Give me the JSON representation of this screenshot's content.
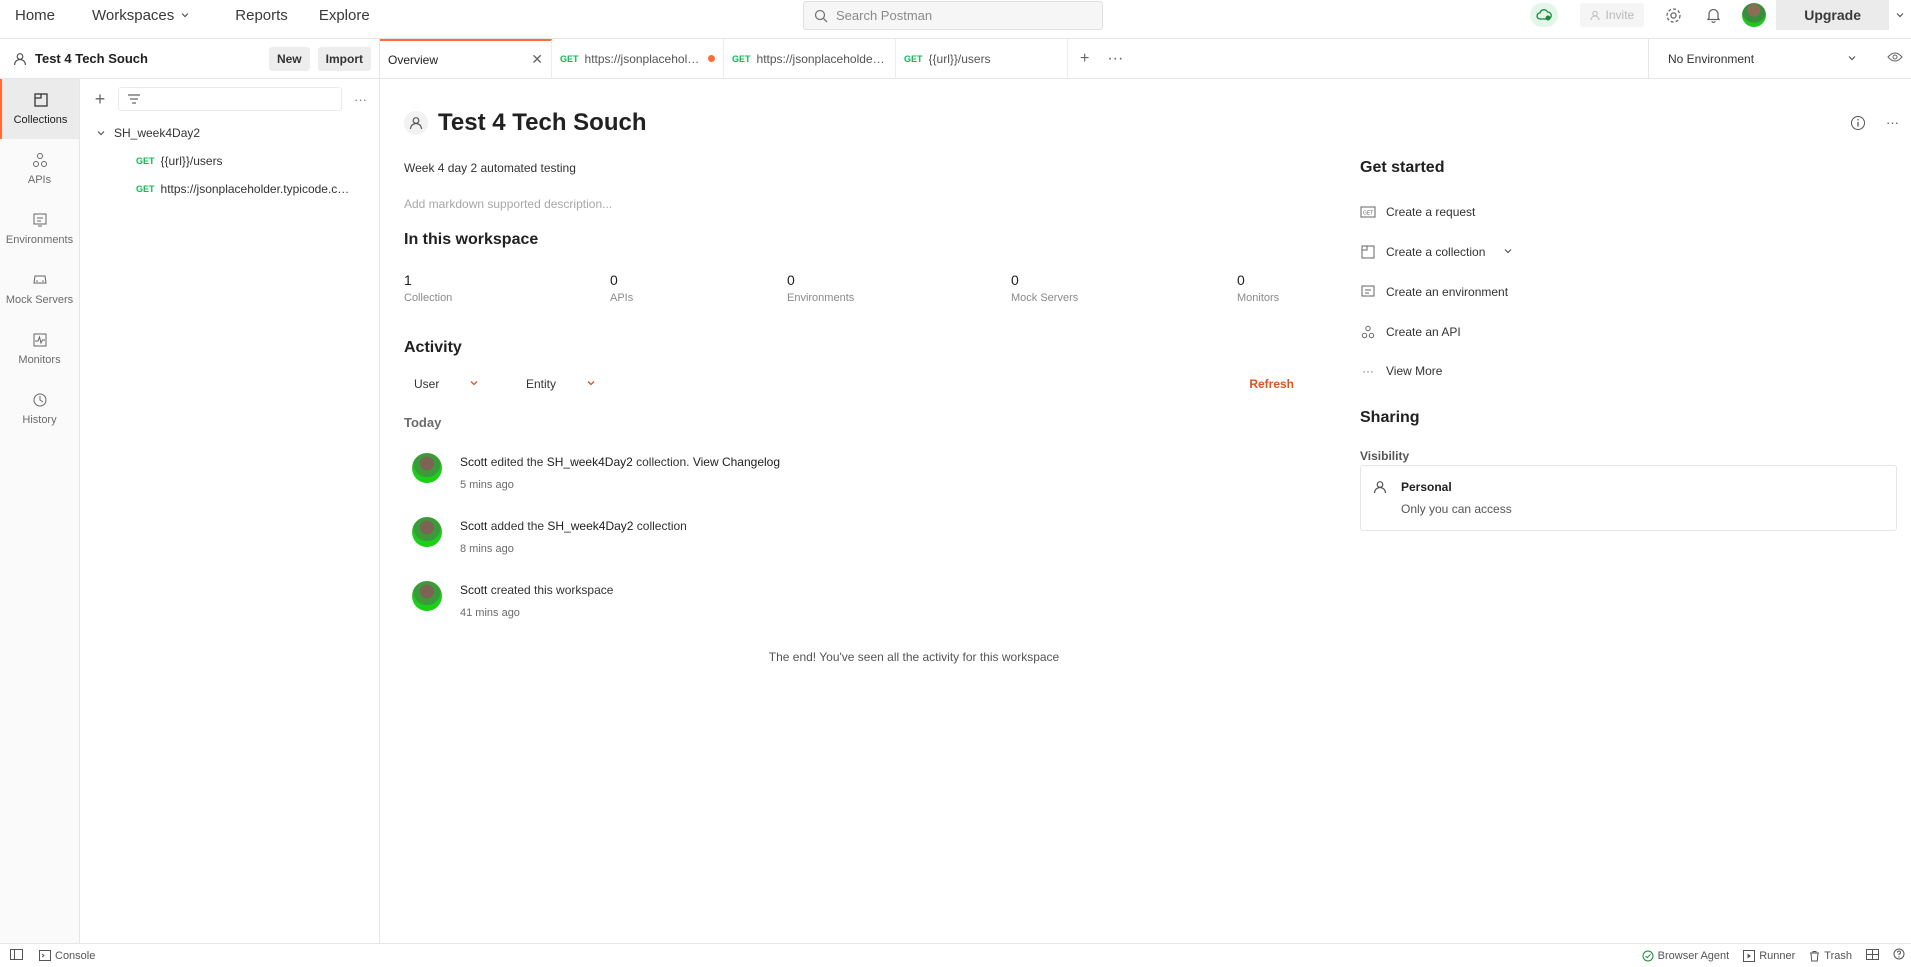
{
  "topnav": {
    "items": [
      {
        "label": "Home"
      },
      {
        "label": "Workspaces"
      },
      {
        "label": "Reports"
      },
      {
        "label": "Explore"
      }
    ],
    "search_placeholder": "Search Postman",
    "invite_label": "Invite",
    "upgrade_label": "Upgrade"
  },
  "workspace": {
    "title": "Test 4 Tech Souch",
    "new_label": "New",
    "import_label": "Import"
  },
  "tabs": [
    {
      "label": "Overview"
    },
    {
      "method": "GET",
      "label": "https://jsonplaceholder.typicode.com"
    },
    {
      "method": "GET",
      "label": "https://jsonplaceholder.typicode.com"
    },
    {
      "method": "GET",
      "label": "{{url}}/users"
    }
  ],
  "environment": {
    "selected": "No Environment"
  },
  "rail": {
    "items": [
      {
        "label": "Collections"
      },
      {
        "label": "APIs"
      },
      {
        "label": "Environments"
      },
      {
        "label": "Mock Servers"
      },
      {
        "label": "Monitors"
      },
      {
        "label": "History"
      }
    ]
  },
  "collections": {
    "tree": {
      "name": "SH_week4Day2",
      "requests": [
        {
          "method": "GET",
          "label": "{{url}}/users"
        },
        {
          "method": "GET",
          "label": "https://jsonplaceholder.typicode.com"
        }
      ]
    }
  },
  "overview": {
    "title": "Test 4 Tech Souch",
    "summary": "Week 4 day 2 automated testing",
    "description_placeholder": "Add markdown supported description...",
    "in_workspace_heading": "In this workspace",
    "stats": [
      {
        "num": "1",
        "label": "Collection"
      },
      {
        "num": "0",
        "label": "APIs"
      },
      {
        "num": "0",
        "label": "Environments"
      },
      {
        "num": "0",
        "label": "Mock Servers"
      },
      {
        "num": "0",
        "label": "Monitors"
      }
    ],
    "activity_heading": "Activity",
    "filter_user": "User",
    "filter_entity": "Entity",
    "refresh_label": "Refresh",
    "today_label": "Today",
    "activities": [
      {
        "user": "Scott",
        "text1": " edited the ",
        "entity": "SH_week4Day2",
        "text2": " collection. ",
        "link": "View Changelog",
        "ago": "5 mins ago"
      },
      {
        "user": "Scott",
        "text1": " added the ",
        "entity": "SH_week4Day2",
        "text2": " collection",
        "link": "",
        "ago": "8 mins ago"
      },
      {
        "user": "Scott",
        "text1": " created this workspace",
        "entity": "",
        "text2": "",
        "link": "",
        "ago": "41 mins ago"
      }
    ],
    "end_text": "The end! You've seen all the activity for this workspace"
  },
  "get_started": {
    "heading": "Get started",
    "items": [
      {
        "label": "Create a request"
      },
      {
        "label": "Create a collection"
      },
      {
        "label": "Create an environment"
      },
      {
        "label": "Create an API"
      },
      {
        "label": "View More"
      }
    ],
    "sharing_heading": "Sharing",
    "visibility_label": "Visibility",
    "personal_title": "Personal",
    "personal_sub": "Only you can access"
  },
  "statusbar": {
    "console": "Console",
    "browser_agent": "Browser Agent",
    "runner": "Runner",
    "trash": "Trash"
  }
}
